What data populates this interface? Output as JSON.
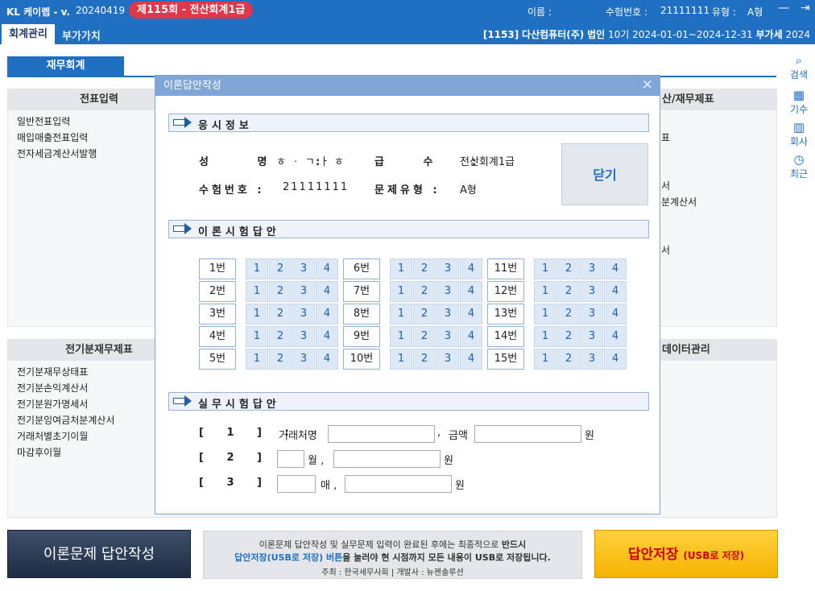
{
  "titlebar": {
    "logo": "KL 케이렙 - v.",
    "version": "20240419",
    "exam_badge": "제115회 - 전산회계1급",
    "name_label": "이름 :",
    "exam_no_label": "수험번호 :",
    "exam_no": "21111111",
    "type_label": "유형 :",
    "type_value": "A형"
  },
  "menubar": {
    "tab_acct": "회계관리",
    "tab_vat": "부가가치",
    "code": "[1153]",
    "company": "다산컴퓨터(주)",
    "entity": "법인",
    "period": "10기 2024-01-01~2024-12-31",
    "vat": "부가세",
    "year": "2024"
  },
  "sidebar": {
    "search": "검색",
    "period": "기수",
    "company": "회사",
    "recent": "최근"
  },
  "background": {
    "fin_tab": "재무회계",
    "voucher_head": "전표입력",
    "voucher_items": [
      "일반전표입력",
      "매입매출전표입력",
      "전자세금계산서발행"
    ],
    "right_head": "산/재무제표",
    "right_items": [
      "표",
      "서",
      "분계산서",
      "서"
    ],
    "prior_head": "전기분재무제표",
    "prior_items": [
      "전기분재무상태표",
      "전기분손익계산서",
      "전기분원가명세서",
      "전기분잉여금처분계산서",
      "거래처별초기이월",
      "마감후이월"
    ],
    "data_head": "데이터관리"
  },
  "dialog": {
    "title": "이론답안작성",
    "sec_info": "응시정보",
    "name_label": "성 명 :",
    "name_value": "ㅎㆍㄱㅏㅎ",
    "grade_label": "급 수 :",
    "grade_value": "전산회계1급",
    "examno_label": "수험번호 :",
    "examno_value": "21111111",
    "type_label": "문제유형 :",
    "type_value": "A형",
    "close_label": "닫기",
    "sec_theory": "이론시험답안",
    "questions": [
      "1번",
      "2번",
      "3번",
      "4번",
      "5번",
      "6번",
      "7번",
      "8번",
      "9번",
      "10번",
      "11번",
      "12번",
      "13번",
      "14번",
      "15번"
    ],
    "options": [
      "1",
      "2",
      "3",
      "4"
    ],
    "sec_practical": "실무시험답안",
    "p1_label": "[ 1 ] :",
    "p1_text_a": "거래처명",
    "p1_sep": ",",
    "p1_text_b": "금액",
    "p1_unit": "원",
    "p2_label": "[ 2 ] :",
    "p2_month": "월 ,",
    "p2_unit": "원",
    "p3_label": "[ 3 ] :",
    "p3_count": "매 ,",
    "p3_unit": "원"
  },
  "bottom": {
    "theory_btn": "이론문제 답안작성",
    "notice_l1a": "이론문제 답안작성 및 실무문제 입력이 완료된 후에는 최종적으로 ",
    "notice_l1b": "반드시",
    "notice_l2a": "답안저장(USB로 저장) 버튼",
    "notice_l2b": "을 눌러야 현 시점까지 모든 내용이 USB로 저장됩니다.",
    "notice_l3": "주최 : 한국세무사회  |  개발사 : 뉴젠솔루션",
    "save_btn": "답안저장",
    "save_small": "(USB로 저장)"
  },
  "colors": {
    "brand_blue": "#1f6fc2",
    "badge_red": "#e0384a",
    "save_yellow": "#f5b300",
    "dialog_border": "#7fa6d6"
  }
}
